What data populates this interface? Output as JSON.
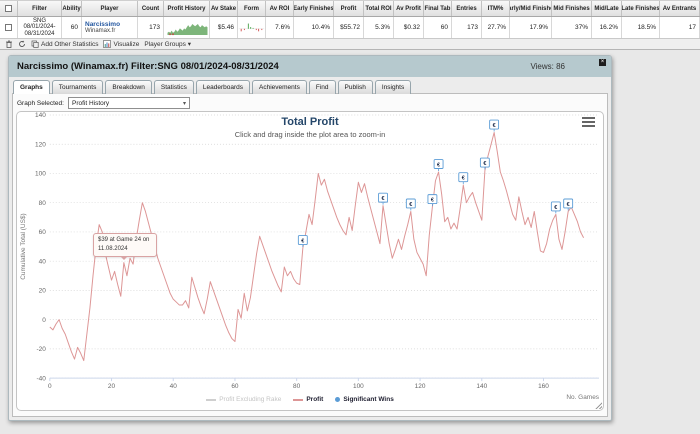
{
  "table": {
    "columns": [
      "Filter",
      "Ability",
      "Player",
      "Count",
      "Profit History",
      "Av Stake",
      "Form",
      "Av ROI",
      "Early Finishes",
      "Profit",
      "Total ROI",
      "Av Profit",
      "Final Tab",
      "Entries",
      "ITM%",
      "Early/Mid Finishes",
      "Mid Finishes",
      "Mid/Late",
      "Late Finishes",
      "Av Entrants"
    ],
    "row": {
      "filter": "SNG 08/01/2024- 08/31/2024",
      "ability": "60",
      "player_name": "Narcissimo",
      "player_site": "Winamax.fr",
      "count": "173",
      "av_stake": "$5.46",
      "av_roi": "7.6%",
      "early_finishes": "10.4%",
      "profit": "$55.72",
      "total_roi": "5.3%",
      "av_profit": "$0.32",
      "final_tab": "60",
      "entries": "173",
      "itm": "27.7%",
      "early_mid_finishes": "17.9%",
      "mid_finishes": "37%",
      "mid_late": "16.2%",
      "late_finishes": "18.5%",
      "av_entrants": "17"
    },
    "toolbar": {
      "add_stats": "Add Other Statistics",
      "visualize": "Visualize",
      "player_groups": "Player Groups ▾"
    }
  },
  "panel": {
    "title": "Narcissimo (Winamax.fr) Filter:SNG 08/01/2024-08/31/2024",
    "views": "Views: 86",
    "close": "×",
    "tabs": [
      "Graphs",
      "Tournaments",
      "Breakdown",
      "Statistics",
      "Leaderboards",
      "Achievements",
      "Find",
      "Publish",
      "Insights"
    ],
    "active_tab": "Graphs",
    "graph_selected_label": "Graph Selected:",
    "graph_selected_value": "Profit History"
  },
  "chart_data": {
    "type": "line",
    "title": "Total Profit",
    "subtitle": "Click and drag inside the plot area to zoom-in",
    "xlabel": "No. Games",
    "ylabel": "Cumulative Total (US$)",
    "xlim": [
      0,
      178
    ],
    "ylim": [
      -40,
      140
    ],
    "x_ticks": [
      0,
      20,
      40,
      60,
      80,
      100,
      120,
      140,
      160
    ],
    "y_ticks": [
      -40,
      -20,
      0,
      20,
      40,
      60,
      80,
      100,
      120,
      140
    ],
    "grid": true,
    "legend_position": "bottom-center",
    "series": [
      {
        "name": "Profit Excluding Rake",
        "color": "#c8c8c8",
        "disabled": true,
        "values": []
      },
      {
        "name": "Profit",
        "color": "#dd9696",
        "values": [
          -5,
          -7,
          -3,
          0,
          -6,
          -10,
          -16,
          -22,
          -27,
          -19,
          -23,
          -28,
          -10,
          8,
          30,
          50,
          65,
          60,
          45,
          36,
          27,
          33,
          24,
          16,
          39,
          30,
          42,
          38,
          55,
          68,
          80,
          74,
          66,
          58,
          50,
          42,
          36,
          30,
          24,
          18,
          14,
          12,
          10,
          10,
          13,
          8,
          29,
          22,
          15,
          9,
          4,
          14,
          26,
          20,
          14,
          8,
          2,
          -4,
          -9,
          -13,
          -15,
          7,
          1,
          18,
          6,
          15,
          30,
          45,
          57,
          51,
          45,
          39,
          33,
          28,
          23,
          19,
          36,
          30,
          33,
          28,
          25,
          24,
          49,
          60,
          72,
          65,
          82,
          100,
          92,
          96,
          88,
          82,
          76,
          70,
          65,
          61,
          58,
          70,
          61,
          78,
          94,
          87,
          93,
          84,
          76,
          68,
          60,
          52,
          78,
          65,
          52,
          42,
          48,
          55,
          48,
          57,
          65,
          74,
          55,
          46,
          42,
          38,
          30,
          58,
          77,
          95,
          101,
          86,
          67,
          70,
          62,
          66,
          62,
          76,
          92,
          80,
          84,
          87,
          80,
          74,
          68,
          102,
          112,
          120,
          128,
          115,
          101,
          95,
          88,
          80,
          72,
          68,
          84,
          74,
          65,
          70,
          63,
          74,
          60,
          47,
          46,
          52,
          62,
          68,
          72,
          55,
          48,
          60,
          74,
          77,
          72,
          67,
          60,
          56
        ]
      },
      {
        "name": "Significant Wins",
        "color": "#5b9cd6",
        "marker_glyph": "€",
        "marker_games": [
          82,
          108,
          117,
          124,
          126,
          134,
          141,
          144,
          164,
          168
        ]
      }
    ],
    "tooltip": {
      "line1": "$39 at Game 24 on",
      "line2": "11.08.2024",
      "game": 24,
      "value": 39
    }
  },
  "sparklines": {
    "profit_history": [
      2,
      3,
      2,
      4,
      2,
      3,
      5,
      3,
      4,
      6,
      5,
      4,
      6,
      5,
      7,
      9,
      7,
      8,
      10,
      9,
      8,
      9,
      10,
      8,
      7,
      9,
      8,
      7,
      8,
      7
    ],
    "profit_history_color": "#7db57a",
    "profit_history_dots": [
      [
        4,
        -1
      ],
      [
        7,
        -1
      ]
    ],
    "form": [
      [
        4,
        -2
      ],
      [
        8,
        -1
      ],
      [
        13,
        6
      ],
      [
        16,
        2
      ],
      [
        19,
        1
      ],
      [
        23,
        -1
      ],
      [
        26,
        -2
      ],
      [
        30,
        -1
      ]
    ],
    "form_pos_color": "#3f9c3f",
    "form_neg_color": "#cc4444"
  }
}
